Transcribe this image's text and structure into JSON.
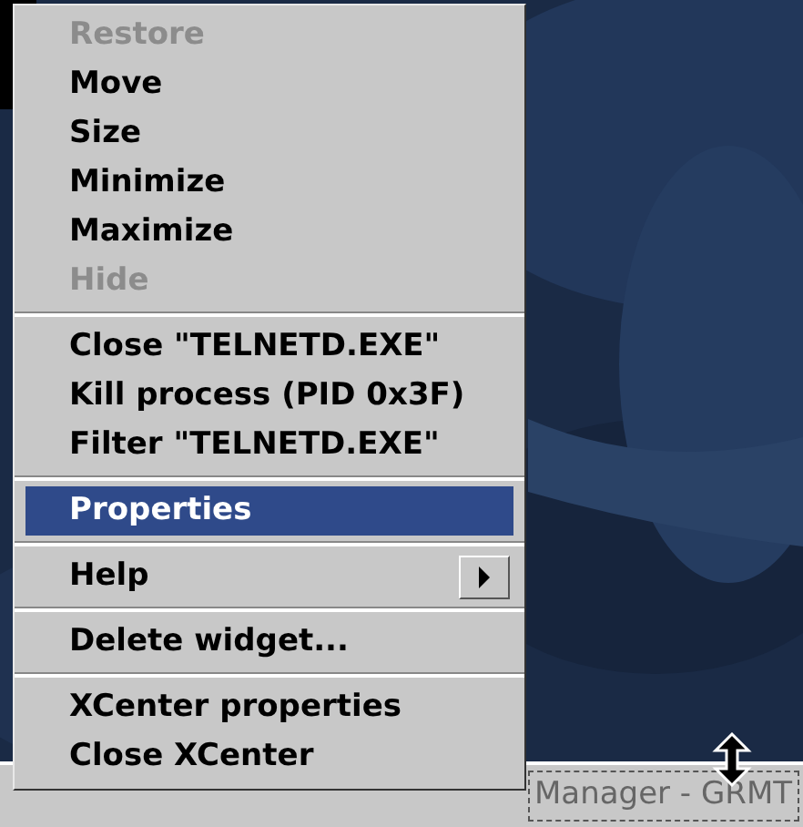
{
  "menu": [
    {
      "kind": "item",
      "label": "Restore",
      "disabled": true,
      "selected": false
    },
    {
      "kind": "item",
      "label": "Move",
      "disabled": false,
      "selected": false
    },
    {
      "kind": "item",
      "label": "Size",
      "disabled": false,
      "selected": false
    },
    {
      "kind": "item",
      "label": "Minimize",
      "disabled": false,
      "selected": false
    },
    {
      "kind": "item",
      "label": "Maximize",
      "disabled": false,
      "selected": false
    },
    {
      "kind": "item",
      "label": "Hide",
      "disabled": true,
      "selected": false
    },
    {
      "kind": "separator"
    },
    {
      "kind": "item",
      "label": "Close \"TELNETD.EXE\"",
      "disabled": false,
      "selected": false
    },
    {
      "kind": "item",
      "label": "Kill process (PID 0x3F)",
      "disabled": false,
      "selected": false
    },
    {
      "kind": "item",
      "label": "Filter \"TELNETD.EXE\"",
      "disabled": false,
      "selected": false
    },
    {
      "kind": "separator"
    },
    {
      "kind": "item",
      "label": "Properties",
      "disabled": false,
      "selected": true
    },
    {
      "kind": "separator"
    },
    {
      "kind": "submenu",
      "label": "Help",
      "disabled": false,
      "selected": false
    },
    {
      "kind": "separator"
    },
    {
      "kind": "item",
      "label": "Delete widget...",
      "disabled": false,
      "selected": false
    },
    {
      "kind": "separator"
    },
    {
      "kind": "item",
      "label": "XCenter properties",
      "disabled": false,
      "selected": false
    },
    {
      "kind": "item",
      "label": "Close XCenter",
      "disabled": false,
      "selected": false
    }
  ],
  "taskbar": {
    "window_button": "Manager - GRMT"
  }
}
